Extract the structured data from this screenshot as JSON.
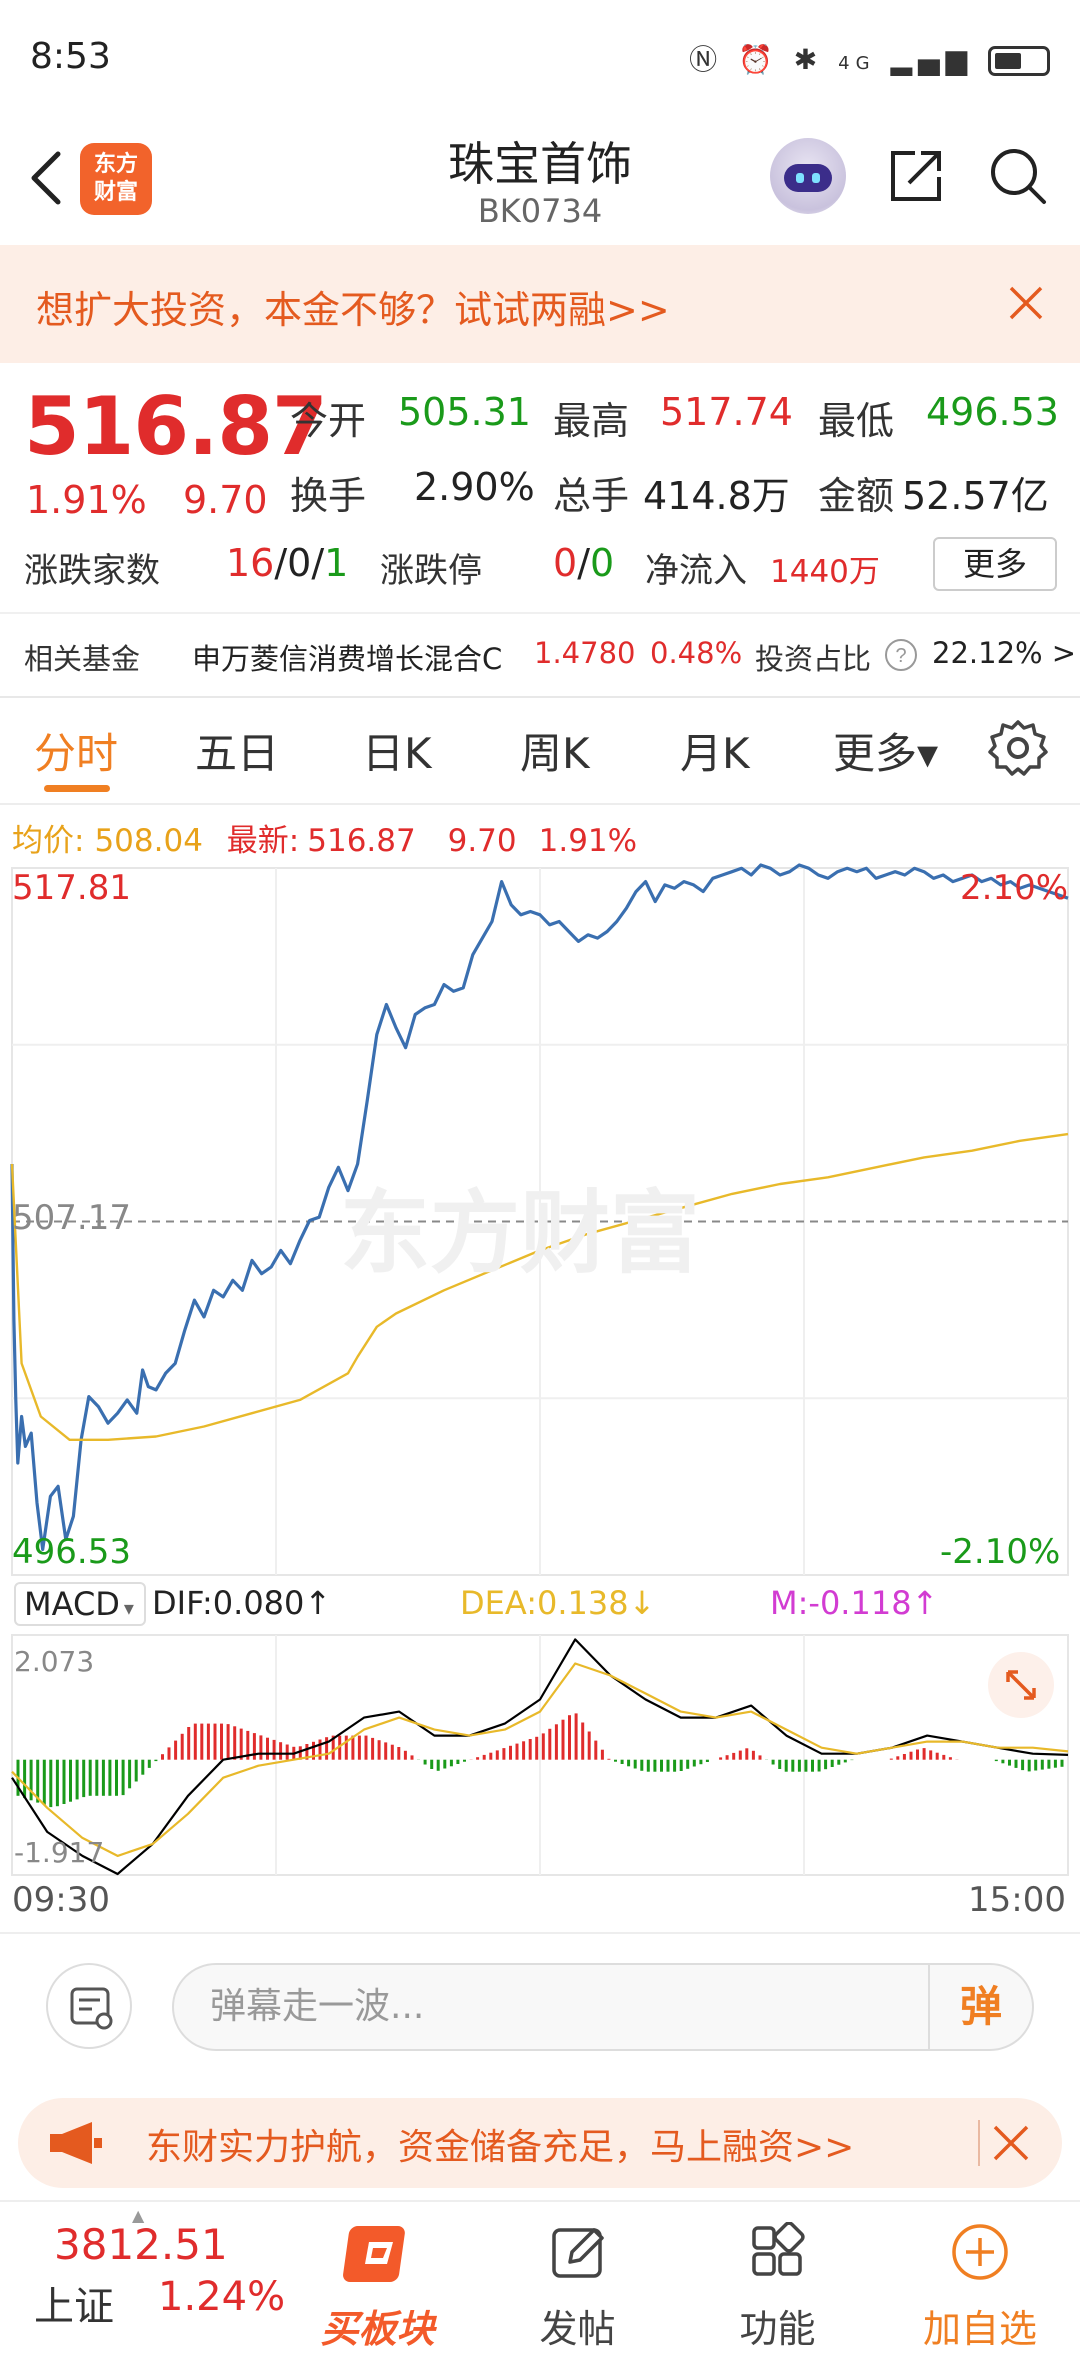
{
  "status_bar": {
    "time": "8:53",
    "network": "4G"
  },
  "header": {
    "title": "珠宝首饰",
    "code": "BK0734",
    "logo_text_1": "东方",
    "logo_text_2": "财富"
  },
  "promo_banner": {
    "text": "想扩大投资，本金不够？试试两融>>"
  },
  "quote": {
    "price": "516.87",
    "change_pct": "1.91%",
    "change_val": "9.70",
    "open_label": "今开",
    "open_value": "505.31",
    "high_label": "最高",
    "high_value": "517.74",
    "low_label": "最低",
    "low_value": "496.53",
    "turnover_label": "换手",
    "turnover_value": "2.90%",
    "volume_label": "总手",
    "volume_value": "414.8万",
    "amount_label": "金额",
    "amount_value": "52.57亿",
    "advdec_label": "涨跌家数",
    "adv": "16",
    "sep1": "/",
    "flat": "0",
    "sep2": "/",
    "dec": "1",
    "limit_label": "涨跌停",
    "limit_up": "0",
    "sep3": "/",
    "limit_down": "0",
    "netflow_label": "净流入",
    "netflow_value": "1440万",
    "more_label": "更多"
  },
  "fund_row": {
    "label": "相关基金",
    "fund_name": "申万菱信消费增长混合C",
    "fund_nav": "1.4780",
    "fund_chg": "0.48%",
    "ratio_label": "投资占比",
    "ratio_value": "22.12% >"
  },
  "tabs": [
    {
      "label": "分时"
    },
    {
      "label": "五日"
    },
    {
      "label": "日K"
    },
    {
      "label": "周K"
    },
    {
      "label": "月K"
    },
    {
      "label": "更多▾"
    }
  ],
  "legend": {
    "avg_label": "均价:",
    "avg_value": "508.04",
    "latest_label": "最新:",
    "latest_value": "516.87",
    "latest_chg": "9.70",
    "latest_pct": "1.91%"
  },
  "chart_labels": {
    "top_price": "517.81",
    "mid_price": "507.17",
    "bottom_price": "496.53",
    "top_pct": "2.10%",
    "bottom_pct": "-2.10%",
    "watermark": "东方财富",
    "time_start": "09:30",
    "time_end": "15:00"
  },
  "macd": {
    "indicator": "MACD",
    "dif_text": "DIF:0.080↑",
    "dea_text": "DEA:0.138↓",
    "m_text": "M:-0.118↑",
    "top": "2.073",
    "bottom": "-1.917"
  },
  "chart_data": [
    {
      "type": "line",
      "title": "",
      "ylim": [
        496.53,
        517.81
      ],
      "series": [
        {
          "name": "最新",
          "color": "#3a6fb0",
          "x": [
            0,
            2,
            4,
            6,
            10,
            14,
            20,
            26,
            32,
            40,
            48,
            56,
            64,
            72,
            80,
            90,
            100,
            110,
            120,
            130,
            136,
            142,
            150,
            160,
            170,
            180,
            190,
            200,
            210,
            220,
            230,
            240,
            250,
            260,
            270,
            280,
            290,
            300,
            310,
            320,
            330,
            340,
            350,
            360,
            370,
            380,
            390,
            400,
            410,
            420,
            430,
            440,
            450,
            460,
            470,
            480,
            490,
            500,
            510,
            520,
            530,
            540,
            550,
            560,
            570,
            580,
            590,
            600,
            610,
            620,
            630,
            640,
            650,
            660,
            670,
            680,
            690,
            700,
            710,
            720,
            730,
            740,
            750,
            760,
            770,
            780,
            790,
            800,
            810,
            820,
            830,
            840,
            850,
            860,
            870,
            880,
            890,
            900,
            910,
            920,
            930,
            940,
            950,
            960,
            970,
            980,
            990,
            1000,
            1010,
            1020,
            1030,
            1040,
            1050,
            1060,
            1070,
            1080,
            1090,
            1100
          ],
          "values": [
            508.9,
            504.2,
            501.8,
            499.9,
            501.3,
            500.4,
            500.8,
            498.7,
            497.3,
            498.9,
            499.2,
            497.6,
            498.3,
            500.6,
            501.9,
            501.6,
            501.1,
            501.4,
            501.8,
            501.4,
            502.7,
            502.2,
            502.1,
            502.6,
            502.9,
            503.9,
            504.8,
            504.3,
            505.1,
            504.9,
            505.4,
            505.1,
            506.0,
            505.6,
            505.8,
            506.3,
            505.9,
            506.6,
            507.2,
            507.3,
            508.2,
            508.8,
            508.1,
            508.9,
            510.8,
            512.8,
            513.7,
            513.0,
            512.4,
            513.4,
            513.6,
            513.7,
            514.3,
            514.1,
            514.2,
            515.2,
            515.7,
            516.2,
            517.4,
            516.7,
            516.4,
            516.5,
            516.4,
            516.1,
            516.2,
            515.9,
            515.6,
            515.8,
            515.7,
            515.9,
            516.2,
            516.6,
            517.1,
            517.4,
            516.8,
            517.3,
            517.2,
            517.4,
            517.3,
            517.1,
            517.5,
            517.6,
            517.7,
            517.8,
            517.6,
            517.9,
            517.8,
            517.6,
            517.7,
            517.9,
            517.8,
            517.6,
            517.5,
            517.7,
            517.8,
            517.7,
            517.8,
            517.5,
            517.6,
            517.7,
            517.6,
            517.8,
            517.7,
            517.5,
            517.6,
            517.4,
            517.5,
            517.6,
            517.4,
            517.5,
            517.3,
            517.4,
            517.2,
            517.3,
            517.2,
            517.1,
            517.0,
            516.9
          ]
        },
        {
          "name": "均价",
          "color": "#e8b92a",
          "x": [
            0,
            10,
            30,
            60,
            100,
            150,
            200,
            250,
            300,
            350,
            360,
            380,
            400,
            450,
            500,
            550,
            600,
            650,
            700,
            750,
            800,
            850,
            900,
            950,
            1000,
            1050,
            1100
          ],
          "values": [
            508.9,
            502.9,
            501.3,
            500.6,
            500.6,
            500.7,
            501.0,
            501.4,
            501.8,
            502.6,
            503.1,
            504.0,
            504.4,
            505.1,
            505.7,
            506.3,
            506.8,
            507.2,
            507.6,
            508.0,
            508.3,
            508.5,
            508.8,
            509.1,
            509.3,
            509.6,
            509.8
          ]
        }
      ]
    },
    {
      "type": "bar",
      "title": "MACD",
      "ylim": [
        -1.917,
        2.073
      ],
      "series": [
        {
          "name": "DIF",
          "color": "#000000",
          "values": [
            -0.3,
            -1.2,
            -1.6,
            -1.9,
            -1.4,
            -0.6,
            0.0,
            0.1,
            0.1,
            0.3,
            0.7,
            0.8,
            0.4,
            0.4,
            0.6,
            1.0,
            2.0,
            1.4,
            1.0,
            0.7,
            0.7,
            0.9,
            0.4,
            0.1,
            0.1,
            0.2,
            0.4,
            0.3,
            0.2,
            0.1,
            0.08
          ]
        },
        {
          "name": "DEA",
          "color": "#e8b92a",
          "values": [
            -0.2,
            -0.8,
            -1.3,
            -1.6,
            -1.4,
            -0.9,
            -0.3,
            -0.1,
            0.0,
            0.1,
            0.5,
            0.7,
            0.5,
            0.4,
            0.5,
            0.8,
            1.6,
            1.4,
            1.1,
            0.8,
            0.7,
            0.8,
            0.5,
            0.2,
            0.1,
            0.2,
            0.3,
            0.3,
            0.2,
            0.2,
            0.138
          ]
        },
        {
          "name": "M",
          "color": "#d23cd2",
          "values": [
            -0.6,
            -0.8,
            -0.6,
            -0.6,
            0.0,
            0.6,
            0.6,
            0.4,
            0.2,
            0.4,
            0.4,
            0.2,
            -0.2,
            0.0,
            0.2,
            0.4,
            0.8,
            0.0,
            -0.2,
            -0.2,
            0.0,
            0.2,
            -0.2,
            -0.2,
            0.0,
            0.0,
            0.2,
            0.0,
            0.0,
            -0.2,
            -0.118
          ]
        }
      ]
    }
  ],
  "colors": {
    "up": "#e02c2c",
    "down": "#1a9a1a",
    "accent": "#f07f22"
  },
  "comment_bar": {
    "placeholder": "弹幕走一波...",
    "danmu_label": "弹"
  },
  "bottom_banner": {
    "text": "东财实力护航，资金储备充足，马上融资>>"
  },
  "bottom_nav": {
    "index_value": "3812.51",
    "index_name": "上证",
    "index_pct": "1.24%",
    "items": [
      {
        "label": "买板块"
      },
      {
        "label": "发帖"
      },
      {
        "label": "功能"
      },
      {
        "label": "加自选"
      }
    ]
  }
}
